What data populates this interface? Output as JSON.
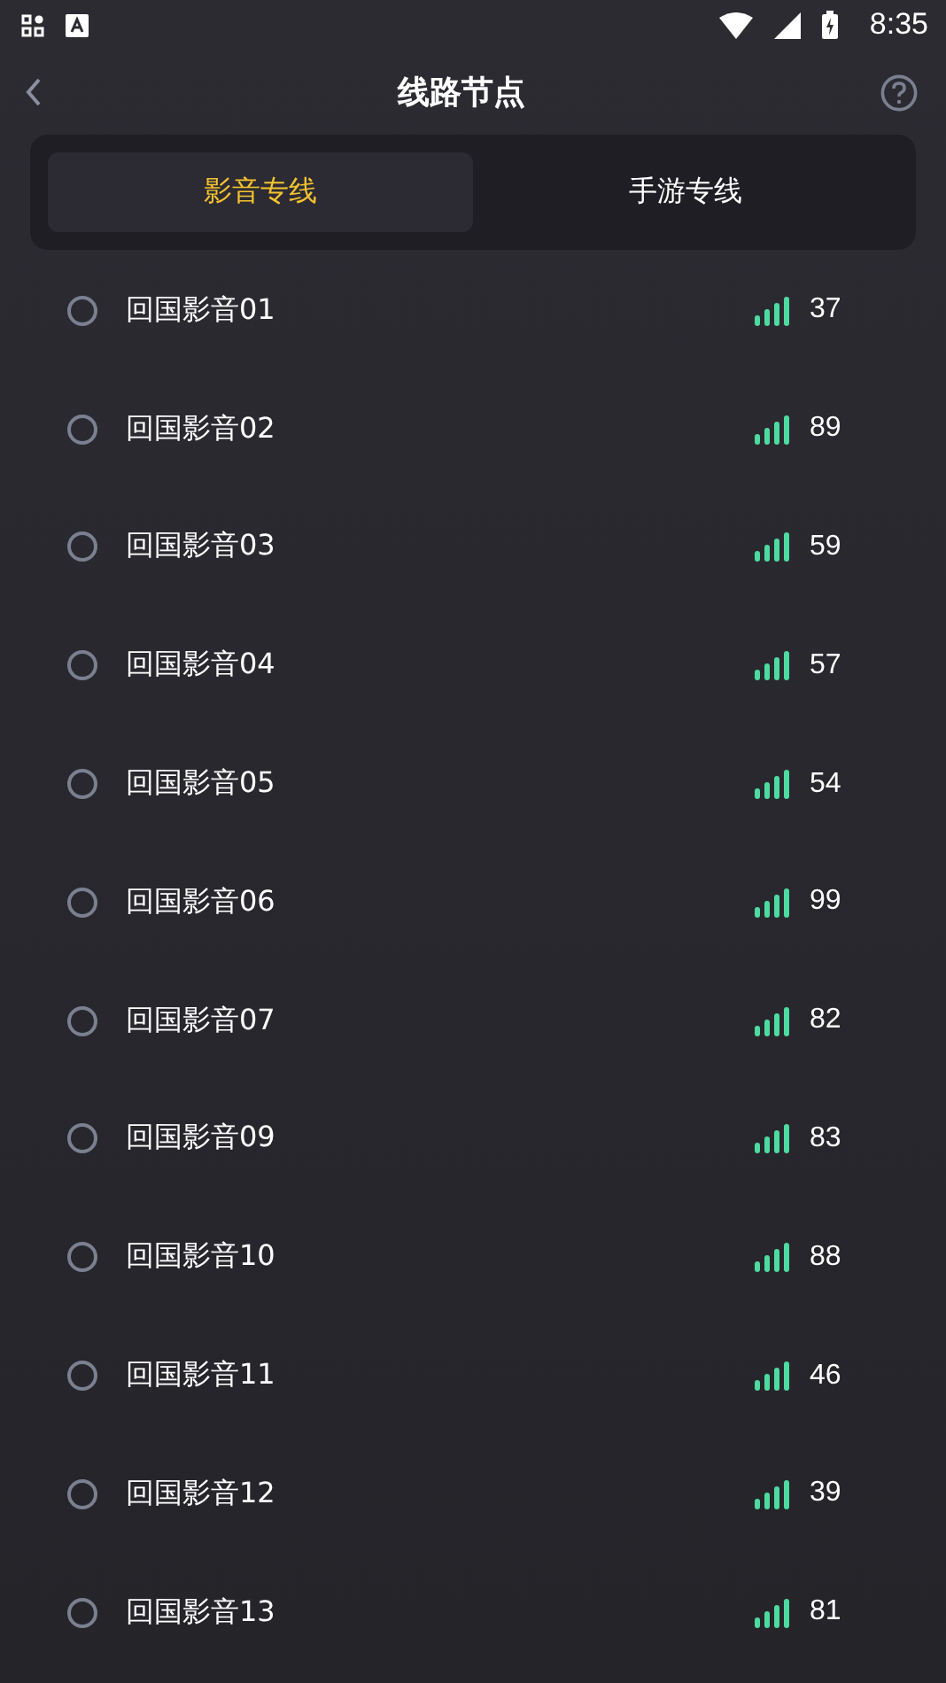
{
  "status_bar": {
    "time": "8:35"
  },
  "header": {
    "title": "线路节点"
  },
  "tabs": [
    {
      "label": "影音专线",
      "selected": true
    },
    {
      "label": "手游专线",
      "selected": false
    }
  ],
  "nodes": [
    {
      "name": "回国影音01",
      "ping": "37",
      "selected": false
    },
    {
      "name": "回国影音02",
      "ping": "89",
      "selected": false
    },
    {
      "name": "回国影音03",
      "ping": "59",
      "selected": false
    },
    {
      "name": "回国影音04",
      "ping": "57",
      "selected": false
    },
    {
      "name": "回国影音05",
      "ping": "54",
      "selected": false
    },
    {
      "name": "回国影音06",
      "ping": "99",
      "selected": false
    },
    {
      "name": "回国影音07",
      "ping": "82",
      "selected": false
    },
    {
      "name": "回国影音09",
      "ping": "83",
      "selected": false
    },
    {
      "name": "回国影音10",
      "ping": "88",
      "selected": false
    },
    {
      "name": "回国影音11",
      "ping": "46",
      "selected": false
    },
    {
      "name": "回国影音12",
      "ping": "39",
      "selected": false
    },
    {
      "name": "回国影音13",
      "ping": "81",
      "selected": false
    }
  ]
}
